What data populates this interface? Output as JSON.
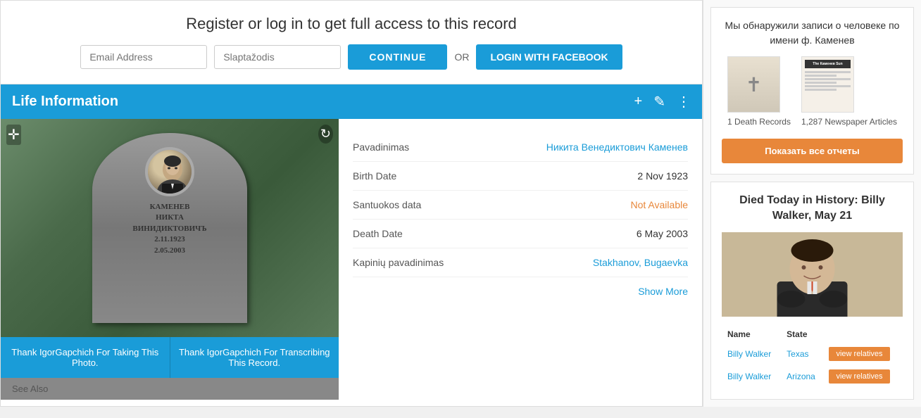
{
  "page": {
    "title": "Register or log in to get full access to this record"
  },
  "register": {
    "title": "Register or log in to get full access to this record",
    "email_placeholder": "Email Address",
    "password_placeholder": "Slaptažodis",
    "continue_label": "CONTINUE",
    "or_label": "OR",
    "facebook_label": "LOGIN WITH FACEBOOK"
  },
  "life_info": {
    "header": "Life Information",
    "add_icon": "+",
    "edit_icon": "✎",
    "more_icon": "⋮",
    "fields": [
      {
        "label": "Pavadinimas",
        "value": "Никита Венедиктович Каменев",
        "color": "russian"
      },
      {
        "label": "Birth Date",
        "value": "2 Nov 1923",
        "color": "normal"
      },
      {
        "label": "Santuokos data",
        "value": "Not Available",
        "color": "orange"
      },
      {
        "label": "Death Date",
        "value": "6 May 2003",
        "color": "normal"
      },
      {
        "label": "Kapinių pavadinimas",
        "value": "Stakhanov, Bugaevka",
        "color": "blue"
      }
    ],
    "show_more": "Show More",
    "gravestone_text": "КАМЕНЕВ\nНИКТА\nВИНИДИКТОВИЧ\n2.11.1923\n2.05.2003",
    "thank_photo": "Thank IgorGapchich For Taking This Photo.",
    "thank_transcribe": "Thank IgorGapchich For Transcribing This Record.",
    "see_also": "See Also"
  },
  "sidebar": {
    "records_title": "Мы обнаружили записи о человеке по имени ф. Каменев",
    "death_records": {
      "count": "1 Death Records",
      "thumbnail_alt": "death-record-thumbnail"
    },
    "newspaper_records": {
      "count": "1,287 Newspaper Articles",
      "thumbnail_alt": "newspaper-thumbnail",
      "header_text": "The Каменев Sun"
    },
    "show_reports_label": "Показать все отчеты",
    "died_today_title": "Died Today in History: Billy Walker, May 21",
    "table": {
      "col_name": "Name",
      "col_state": "State",
      "col_action": "",
      "rows": [
        {
          "name": "Billy Walker",
          "state": "Texas",
          "action": "view relatives"
        },
        {
          "name": "Billy Walker",
          "state": "Arizona",
          "action": "view relatives"
        }
      ]
    }
  }
}
